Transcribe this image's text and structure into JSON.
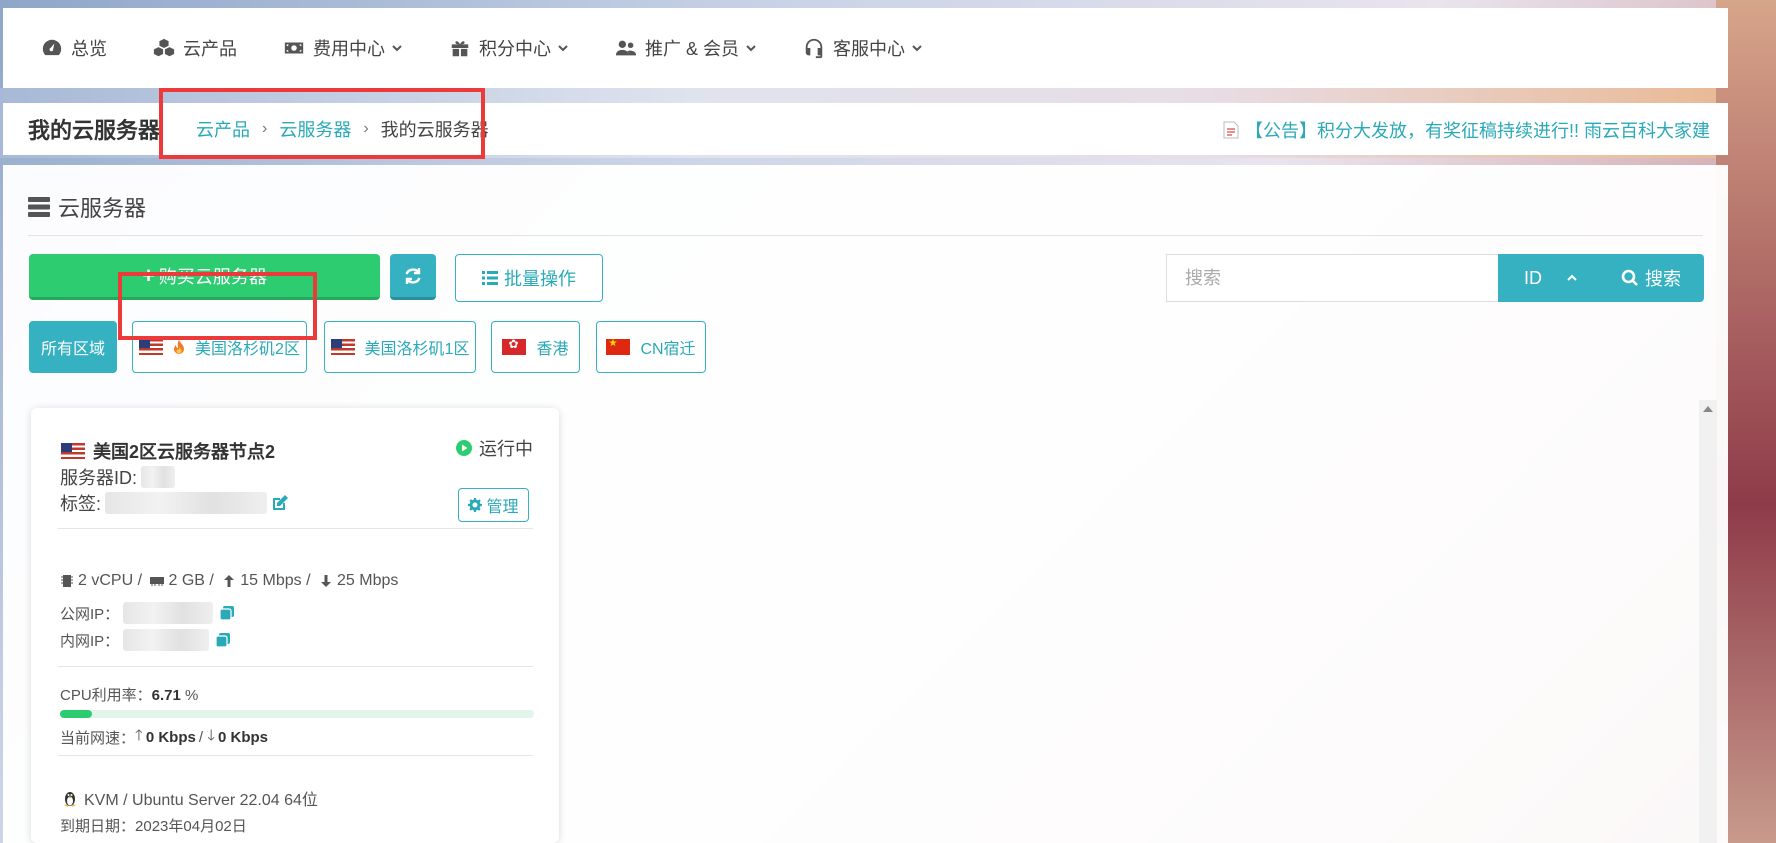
{
  "nav": {
    "items": [
      {
        "label": "总览",
        "icon": "dashboard-icon",
        "dropdown": false
      },
      {
        "label": "云产品",
        "icon": "cubes-icon",
        "dropdown": false
      },
      {
        "label": "费用中心",
        "icon": "money-icon",
        "dropdown": true
      },
      {
        "label": "积分中心",
        "icon": "gift-icon",
        "dropdown": true
      },
      {
        "label": "推广 & 会员",
        "icon": "users-icon",
        "dropdown": true
      },
      {
        "label": "客服中心",
        "icon": "headset-icon",
        "dropdown": true
      }
    ]
  },
  "titlebar": {
    "title": "我的云服务器",
    "breadcrumb": [
      "云产品",
      "云服务器",
      "我的云服务器"
    ],
    "announcement": "【公告】积分大发放，有奖征稿持续进行!! 雨云百科大家建"
  },
  "panel": {
    "heading": "云服务器",
    "buy_label": "购买云服务器",
    "batch_label": "批量操作",
    "search": {
      "placeholder": "搜索",
      "field": "ID",
      "button_label": "搜索"
    },
    "regions": [
      {
        "label": "所有区域",
        "active": true,
        "flag": ""
      },
      {
        "label": "美国洛杉矶2区",
        "active": false,
        "flag": "us",
        "hot": true
      },
      {
        "label": "美国洛杉矶1区",
        "active": false,
        "flag": "us"
      },
      {
        "label": "香港",
        "active": false,
        "flag": "hk"
      },
      {
        "label": "CN宿迁",
        "active": false,
        "flag": "cn"
      }
    ]
  },
  "server_card": {
    "name": "美国2区云服务器节点2",
    "status": "运行中",
    "server_id_label": "服务器ID:",
    "tag_label": "标签:",
    "manage_label": "管理",
    "cpu": "2 vCPU",
    "ram": "2 GB",
    "up_bw": "15 Mbps",
    "down_bw": "25 Mbps",
    "public_ip_label": "公网IP：",
    "private_ip_label": "内网IP：",
    "cpu_usage_label": "CPU利用率：",
    "cpu_usage_value": "6.71",
    "cpu_usage_unit": "%",
    "cpu_usage_fraction": 0.0671,
    "net_speed_label": "当前网速：",
    "net_up": "0 Kbps",
    "net_down": "0 Kbps",
    "os": "KVM / Ubuntu Server 22.04 64位",
    "expiry_label": "到期日期：",
    "expiry_value": "2023年04月02日"
  },
  "colors": {
    "accent": "#35b1c2",
    "success": "#2ecc71",
    "highlight": "#ec3a3a"
  }
}
